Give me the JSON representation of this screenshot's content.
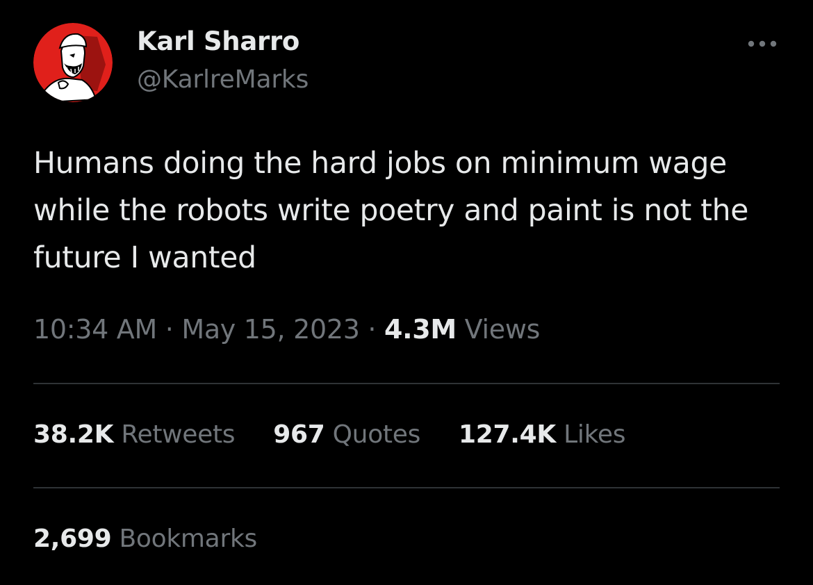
{
  "author": {
    "display_name": "Karl Sharro",
    "handle": "@KarlreMarks",
    "avatar_icon": "profile-avatar-illustration",
    "avatar_color": "#e0201b"
  },
  "more_icon": "more-horizontal-icon",
  "tweet": {
    "text": "Humans doing the hard jobs on minimum wage while the robots write poetry and paint is not the future I wanted"
  },
  "meta": {
    "time": "10:34 AM",
    "separator": " · ",
    "date": "May 15, 2023",
    "views_count": "4.3M",
    "views_label": " Views"
  },
  "stats": {
    "retweets_count": "38.2K",
    "retweets_label": " Retweets",
    "quotes_count": "967",
    "quotes_label": " Quotes",
    "likes_count": "127.4K",
    "likes_label": " Likes",
    "bookmarks_count": "2,699",
    "bookmarks_label": " Bookmarks"
  },
  "colors": {
    "background": "#000000",
    "primary_text": "#e7e9ea",
    "secondary_text": "#71767b",
    "divider": "#2f3336"
  }
}
